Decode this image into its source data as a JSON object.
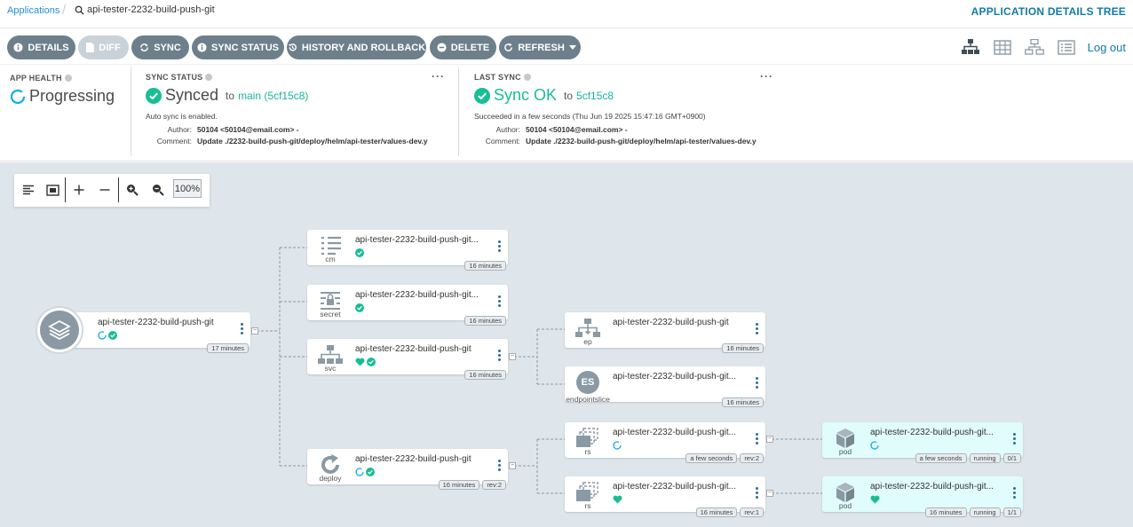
{
  "breadcrumb": {
    "root_label": "Applications",
    "separator": "/",
    "app_name": "api-tester-2232-build-push-git"
  },
  "page_title": "APPLICATION DETAILS TREE",
  "toolbar": {
    "details": "DETAILS",
    "diff": "DIFF",
    "sync": "SYNC",
    "sync_status": "SYNC STATUS",
    "history": "HISTORY AND ROLLBACK",
    "delete": "DELETE",
    "refresh": "REFRESH"
  },
  "logout": "Log out",
  "app_health": {
    "title": "APP HEALTH",
    "status": "Progressing"
  },
  "sync_status": {
    "title": "SYNC STATUS",
    "status": "Synced",
    "to": "to",
    "revision": "main (5cf15c8)",
    "auto_sync": "Auto sync is enabled.",
    "author_label": "Author:",
    "author": "50104 <50104@email.com> -",
    "comment_label": "Comment:",
    "comment": "Update ./2232-build-push-git/deploy/helm/api-tester/values-dev.y",
    "more": "···"
  },
  "last_sync": {
    "title": "LAST SYNC",
    "status": "Sync OK",
    "to": "to",
    "revision": "5cf15c8",
    "succeeded": "Succeeded in a few seconds (Thu Jun 19 2025 15:47:16 GMT+0900)",
    "author_label": "Author:",
    "author": "50104 <50104@email.com> -",
    "comment_label": "Comment:",
    "comment": "Update ./2232-build-push-git/deploy/helm/api-tester/values-dev.y",
    "more": "···"
  },
  "zoom": {
    "level": "100%"
  },
  "colors": {
    "accent": "#117aa8",
    "synced": "#18be94",
    "progressing": "#0dadea",
    "button": "#6d7f8b"
  },
  "tree": {
    "app": {
      "name": "api-tester-2232-build-push-git",
      "age": "17 minutes"
    },
    "cm": {
      "kind": "cm",
      "name": "api-tester-2232-build-push-git...",
      "age": "16 minutes"
    },
    "secret": {
      "kind": "secret",
      "name": "api-tester-2232-build-push-git...",
      "age": "16 minutes"
    },
    "svc": {
      "kind": "svc",
      "name": "api-tester-2232-build-push-git",
      "age": "16 minutes"
    },
    "deploy": {
      "kind": "deploy",
      "name": "api-tester-2232-build-push-git",
      "age": "16 minutes",
      "rev": "rev:2"
    },
    "ep": {
      "kind": "ep",
      "name": "api-tester-2232-build-push-git",
      "age": "16 minutes"
    },
    "endpointslice": {
      "kind": "endpointslice",
      "badge": "ES",
      "name": "api-tester-2232-build-push-git...",
      "age": "16 minutes"
    },
    "rs1": {
      "kind": "rs",
      "name": "api-tester-2232-build-push-git...",
      "age": "a few seconds",
      "rev": "rev:2"
    },
    "rs2": {
      "kind": "rs",
      "name": "api-tester-2232-build-push-git...",
      "age": "16 minutes",
      "rev": "rev:1"
    },
    "pod1": {
      "kind": "pod",
      "name": "api-tester-2232-build-push-git...",
      "age": "a few seconds",
      "state": "running",
      "ready": "0/1"
    },
    "pod2": {
      "kind": "pod",
      "name": "api-tester-2232-build-push-git...",
      "age": "16 minutes",
      "state": "running",
      "ready": "1/1"
    }
  }
}
